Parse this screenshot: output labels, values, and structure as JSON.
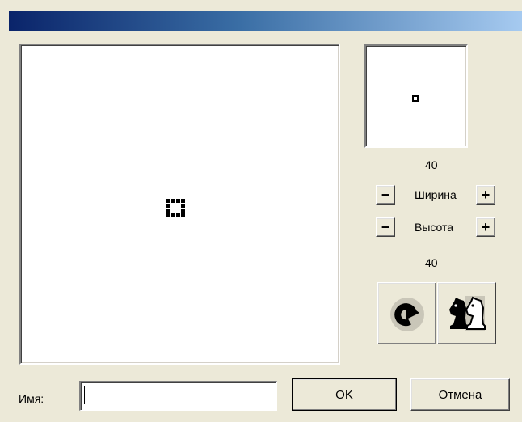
{
  "window": {
    "title": ""
  },
  "size_panel": {
    "width_value": "40",
    "height_value": "40",
    "width_label": "Ширина",
    "height_label": "Высота",
    "minus_label": "−",
    "plus_label": "+"
  },
  "footer": {
    "name_label": "Имя:",
    "name_value": "",
    "ok_label": "OK",
    "cancel_label": "Отмена"
  },
  "icons": {
    "rotate": "rotate-clockwise-icon",
    "chess": "chess-knight-icon"
  },
  "colors": {
    "title_gradient_start": "#0a246a",
    "title_gradient_end": "#a6caf0",
    "dialog_face": "#ece9d8",
    "canvas_background": "#ffffff",
    "pixel": "#000000"
  }
}
